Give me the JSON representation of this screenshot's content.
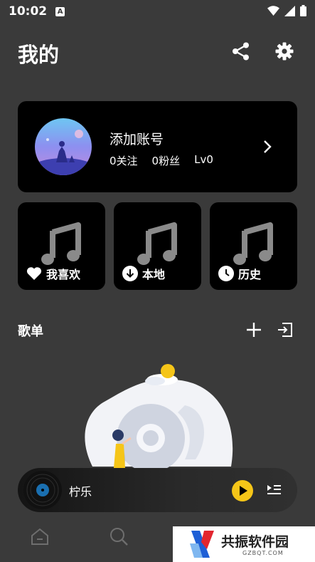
{
  "status_bar": {
    "time": "10:02",
    "notification_letter": "A"
  },
  "header": {
    "title": "我的",
    "share_icon": "share-icon",
    "settings_icon": "gear-icon"
  },
  "account": {
    "name": "添加账号",
    "follow": "0关注",
    "fans": "0粉丝",
    "level": "Lv0"
  },
  "tiles": [
    {
      "label": "我喜欢",
      "icon": "heart-icon"
    },
    {
      "label": "本地",
      "icon": "download-icon"
    },
    {
      "label": "历史",
      "icon": "clock-icon"
    }
  ],
  "playlist": {
    "title": "歌单",
    "add_icon": "plus-icon",
    "import_icon": "import-icon"
  },
  "player": {
    "title": "柠乐",
    "accent": "#f5c518"
  },
  "nav": {
    "items": [
      "home-icon",
      "search-icon"
    ]
  },
  "watermark": {
    "text": "共振软件园",
    "sub": "GZBQT.COM"
  },
  "colors": {
    "background": "#3a3a3a",
    "card": "#000000",
    "accent": "#f5c518"
  }
}
